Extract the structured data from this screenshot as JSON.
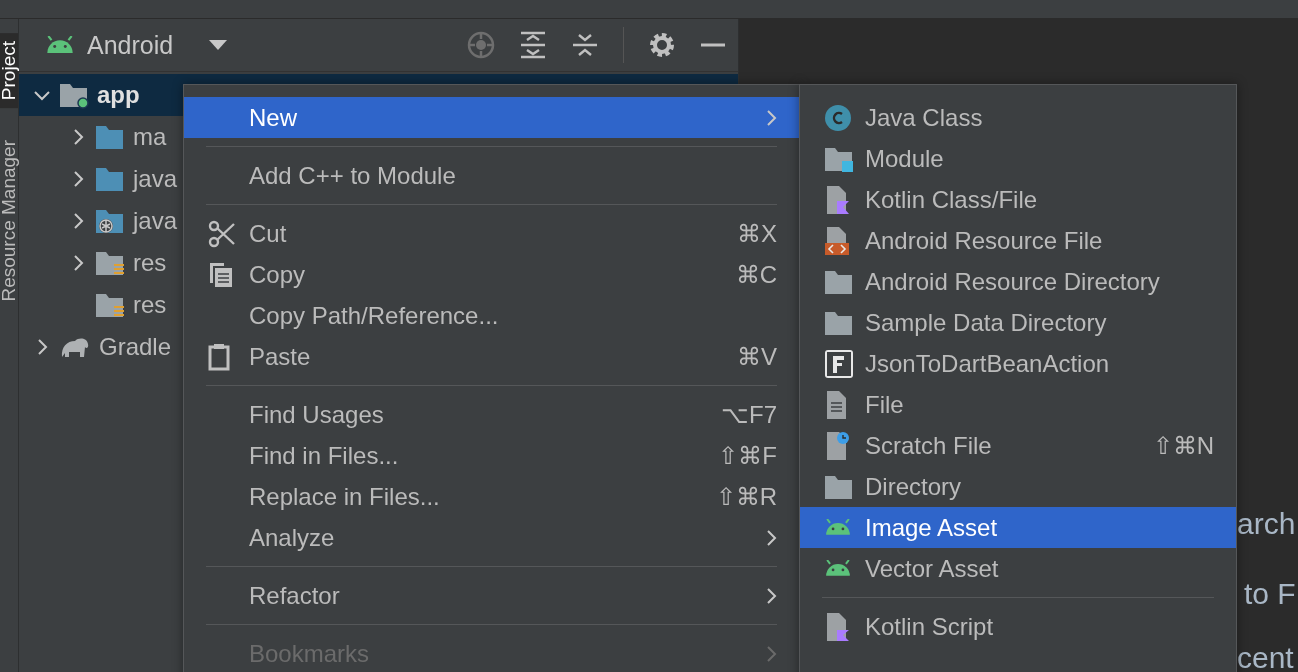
{
  "tool_strip": [
    {
      "label": "Project",
      "selected": true
    },
    {
      "label": "Resource Manager",
      "selected": false
    }
  ],
  "project_panel": {
    "view": "Android",
    "tree": [
      {
        "label": "app",
        "selected": true,
        "expanded": true,
        "children": [
          {
            "label": "ma",
            "selected": false,
            "expanded": false
          },
          {
            "label": "java",
            "selected": false,
            "expanded": false
          },
          {
            "label": "java",
            "selected": false,
            "expanded": false
          },
          {
            "label": "res",
            "selected": false,
            "expanded": false
          },
          {
            "label": "res",
            "selected": false
          }
        ]
      },
      {
        "label": "Gradle",
        "selected": false,
        "expanded": false
      }
    ]
  },
  "editor_hints": [
    "arch",
    "to F",
    "cent"
  ],
  "context_menu": [
    {
      "kind": "item",
      "label": "New",
      "selected": true,
      "disabled": false,
      "submenu": true
    },
    {
      "kind": "separator"
    },
    {
      "kind": "item",
      "label": "Add C++ to Module",
      "selected": false,
      "disabled": false,
      "submenu": false
    },
    {
      "kind": "separator"
    },
    {
      "kind": "item",
      "label": "Cut",
      "shortcut": "⌘X",
      "selected": false,
      "disabled": false,
      "submenu": false
    },
    {
      "kind": "item",
      "label": "Copy",
      "shortcut": "⌘C",
      "selected": false,
      "disabled": false,
      "submenu": false
    },
    {
      "kind": "item",
      "label": "Copy Path/Reference...",
      "selected": false,
      "disabled": false,
      "submenu": false
    },
    {
      "kind": "item",
      "label": "Paste",
      "shortcut": "⌘V",
      "selected": false,
      "disabled": false,
      "submenu": false
    },
    {
      "kind": "separator"
    },
    {
      "kind": "item",
      "label": "Find Usages",
      "shortcut": "⌥F7",
      "selected": false,
      "disabled": false,
      "submenu": false
    },
    {
      "kind": "item",
      "label": "Find in Files...",
      "shortcut": "⇧⌘F",
      "selected": false,
      "disabled": false,
      "submenu": false
    },
    {
      "kind": "item",
      "label": "Replace in Files...",
      "shortcut": "⇧⌘R",
      "selected": false,
      "disabled": false,
      "submenu": false
    },
    {
      "kind": "item",
      "label": "Analyze",
      "selected": false,
      "disabled": false,
      "submenu": true
    },
    {
      "kind": "separator"
    },
    {
      "kind": "item",
      "label": "Refactor",
      "selected": false,
      "disabled": false,
      "submenu": true
    },
    {
      "kind": "separator"
    },
    {
      "kind": "item",
      "label": "Bookmarks",
      "selected": false,
      "disabled": true,
      "submenu": true
    }
  ],
  "new_submenu": [
    {
      "kind": "item",
      "label": "Java Class",
      "selected": false
    },
    {
      "kind": "item",
      "label": "Module",
      "selected": false
    },
    {
      "kind": "item",
      "label": "Kotlin Class/File",
      "selected": false
    },
    {
      "kind": "item",
      "label": "Android Resource File",
      "selected": false
    },
    {
      "kind": "item",
      "label": "Android Resource Directory",
      "selected": false
    },
    {
      "kind": "item",
      "label": "Sample Data Directory",
      "selected": false
    },
    {
      "kind": "item",
      "label": "JsonToDartBeanAction",
      "selected": false
    },
    {
      "kind": "item",
      "label": "File",
      "selected": false
    },
    {
      "kind": "item",
      "label": "Scratch File",
      "shortcut": "⇧⌘N",
      "selected": false
    },
    {
      "kind": "item",
      "label": "Directory",
      "selected": false
    },
    {
      "kind": "item",
      "label": "Image Asset",
      "selected": true
    },
    {
      "kind": "item",
      "label": "Vector Asset",
      "selected": false
    },
    {
      "kind": "separator"
    },
    {
      "kind": "item",
      "label": "Kotlin Script",
      "selected": false
    }
  ]
}
